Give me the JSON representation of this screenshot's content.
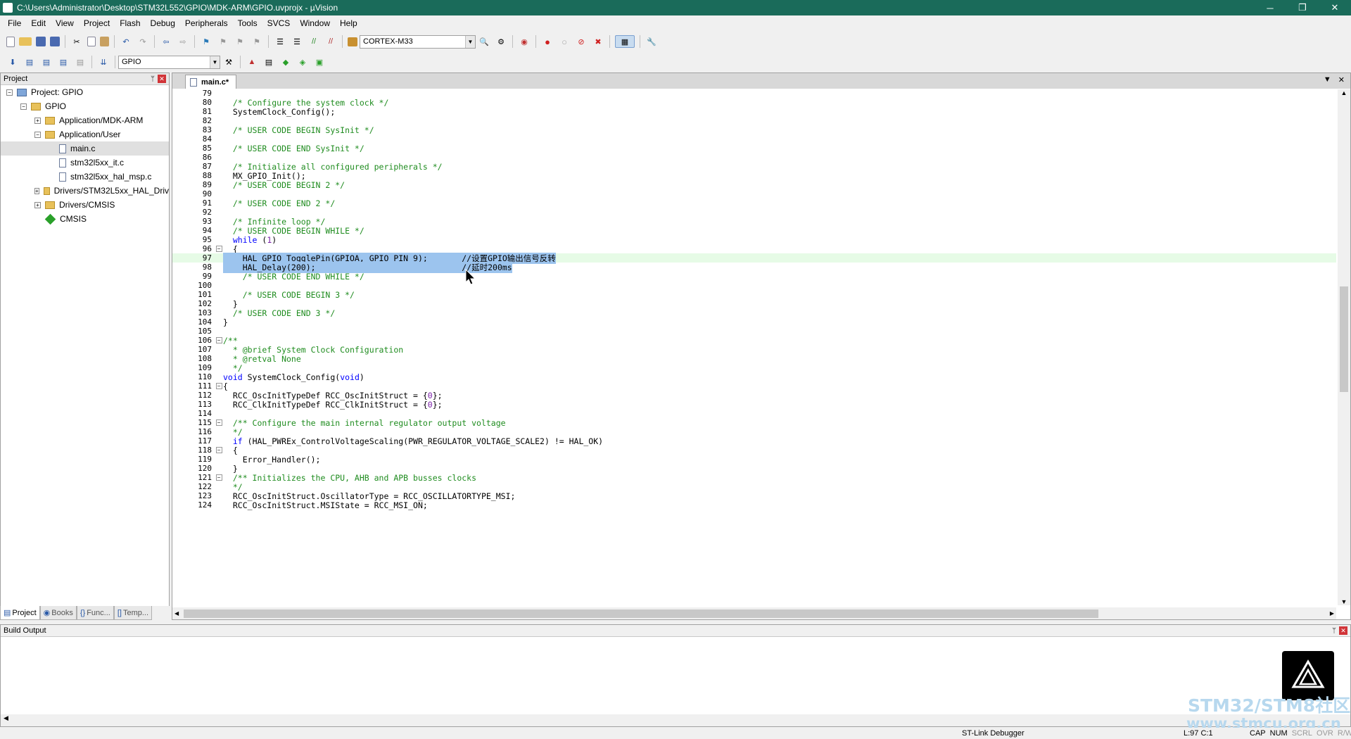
{
  "window": {
    "title": "C:\\Users\\Administrator\\Desktop\\STM32L552\\GPIO\\MDK-ARM\\GPIO.uvprojx - µVision",
    "minimize": "─",
    "maximize": "❐",
    "close": "✕"
  },
  "menu": [
    "File",
    "Edit",
    "View",
    "Project",
    "Flash",
    "Debug",
    "Peripherals",
    "Tools",
    "SVCS",
    "Window",
    "Help"
  ],
  "toolbar": {
    "device_combo": "CORTEX-M33",
    "target_combo": "GPIO"
  },
  "project_panel": {
    "title": "Project",
    "pin": "ᛘ",
    "close": "✕",
    "tree": [
      {
        "label": "Project: GPIO",
        "level": 0,
        "kind": "proj",
        "exp": "−"
      },
      {
        "label": "GPIO",
        "level": 1,
        "kind": "folder",
        "exp": "−"
      },
      {
        "label": "Application/MDK-ARM",
        "level": 2,
        "kind": "folder",
        "exp": "+"
      },
      {
        "label": "Application/User",
        "level": 2,
        "kind": "folder",
        "exp": "−"
      },
      {
        "label": "main.c",
        "level": 3,
        "kind": "file",
        "exp": "",
        "selected": true
      },
      {
        "label": "stm32l5xx_it.c",
        "level": 3,
        "kind": "file",
        "exp": ""
      },
      {
        "label": "stm32l5xx_hal_msp.c",
        "level": 3,
        "kind": "file",
        "exp": ""
      },
      {
        "label": "Drivers/STM32L5xx_HAL_Driv",
        "level": 2,
        "kind": "folder",
        "exp": "+"
      },
      {
        "label": "Drivers/CMSIS",
        "level": 2,
        "kind": "folder",
        "exp": "+"
      },
      {
        "label": "CMSIS",
        "level": 2,
        "kind": "diamond",
        "exp": ""
      }
    ],
    "tabs": [
      {
        "label": "Project",
        "icon": "▤",
        "active": true
      },
      {
        "label": "Books",
        "icon": "◉",
        "active": false
      },
      {
        "label": "Func...",
        "icon": "{}",
        "active": false
      },
      {
        "label": "Temp...",
        "icon": "[]",
        "active": false
      }
    ]
  },
  "editor": {
    "tab": "main.c*",
    "tab_menu": "▼",
    "tab_close": "✕",
    "lines": [
      {
        "n": "79",
        "t": "",
        "fold": ""
      },
      {
        "n": "80",
        "t": "  /* Configure the system clock */",
        "fold": "",
        "cls": "com"
      },
      {
        "n": "81",
        "t": "  SystemClock_Config();",
        "fold": ""
      },
      {
        "n": "82",
        "t": "",
        "fold": ""
      },
      {
        "n": "83",
        "t": "  /* USER CODE BEGIN SysInit */",
        "fold": "",
        "cls": "com"
      },
      {
        "n": "84",
        "t": "",
        "fold": ""
      },
      {
        "n": "85",
        "t": "  /* USER CODE END SysInit */",
        "fold": "",
        "cls": "com"
      },
      {
        "n": "86",
        "t": "",
        "fold": ""
      },
      {
        "n": "87",
        "t": "  /* Initialize all configured peripherals */",
        "fold": "",
        "cls": "com"
      },
      {
        "n": "88",
        "t": "  MX_GPIO_Init();",
        "fold": ""
      },
      {
        "n": "89",
        "t": "  /* USER CODE BEGIN 2 */",
        "fold": "",
        "cls": "com"
      },
      {
        "n": "90",
        "t": "",
        "fold": ""
      },
      {
        "n": "91",
        "t": "  /* USER CODE END 2 */",
        "fold": "",
        "cls": "com"
      },
      {
        "n": "92",
        "t": "",
        "fold": ""
      },
      {
        "n": "93",
        "t": "  /* Infinite loop */",
        "fold": "",
        "cls": "com"
      },
      {
        "n": "94",
        "t": "  /* USER CODE BEGIN WHILE */",
        "fold": "",
        "cls": "com"
      },
      {
        "n": "95",
        "t": "  while (1)",
        "fold": "",
        "cls": "while"
      },
      {
        "n": "96",
        "t": "  {",
        "fold": "−"
      },
      {
        "n": "97",
        "t": "    HAL_GPIO_TogglePin(GPIOA, GPIO_PIN_9);       //设置GPIO输出信号反转",
        "fold": "",
        "sel": true,
        "hl": true
      },
      {
        "n": "98",
        "t": "    HAL_Delay(200);                              //延时200ms",
        "fold": "",
        "sel": true
      },
      {
        "n": "99",
        "t": "    /* USER CODE END WHILE */",
        "fold": "",
        "cls": "com"
      },
      {
        "n": "100",
        "t": "",
        "fold": ""
      },
      {
        "n": "101",
        "t": "    /* USER CODE BEGIN 3 */",
        "fold": "",
        "cls": "com"
      },
      {
        "n": "102",
        "t": "  }",
        "fold": ""
      },
      {
        "n": "103",
        "t": "  /* USER CODE END 3 */",
        "fold": "",
        "cls": "com"
      },
      {
        "n": "104",
        "t": "}",
        "fold": ""
      },
      {
        "n": "105",
        "t": "",
        "fold": ""
      },
      {
        "n": "106",
        "t": "/**",
        "fold": "−",
        "cls": "com"
      },
      {
        "n": "107",
        "t": "  * @brief System Clock Configuration",
        "fold": "",
        "cls": "com"
      },
      {
        "n": "108",
        "t": "  * @retval None",
        "fold": "",
        "cls": "com"
      },
      {
        "n": "109",
        "t": "  */",
        "fold": "",
        "cls": "com"
      },
      {
        "n": "110",
        "t": "void SystemClock_Config(void)",
        "fold": "",
        "cls": "void"
      },
      {
        "n": "111",
        "t": "{",
        "fold": "−"
      },
      {
        "n": "112",
        "t": "  RCC_OscInitTypeDef RCC_OscInitStruct = {0};",
        "fold": ""
      },
      {
        "n": "113",
        "t": "  RCC_ClkInitTypeDef RCC_ClkInitStruct = {0};",
        "fold": ""
      },
      {
        "n": "114",
        "t": "",
        "fold": ""
      },
      {
        "n": "115",
        "t": "  /** Configure the main internal regulator output voltage",
        "fold": "−",
        "cls": "com"
      },
      {
        "n": "116",
        "t": "  */",
        "fold": "",
        "cls": "com"
      },
      {
        "n": "117",
        "t": "  if (HAL_PWREx_ControlVoltageScaling(PWR_REGULATOR_VOLTAGE_SCALE2) != HAL_OK)",
        "fold": "",
        "cls": "if"
      },
      {
        "n": "118",
        "t": "  {",
        "fold": "−"
      },
      {
        "n": "119",
        "t": "    Error_Handler();",
        "fold": ""
      },
      {
        "n": "120",
        "t": "  }",
        "fold": ""
      },
      {
        "n": "121",
        "t": "  /** Initializes the CPU, AHB and APB busses clocks",
        "fold": "−",
        "cls": "com"
      },
      {
        "n": "122",
        "t": "  */",
        "fold": "",
        "cls": "com"
      },
      {
        "n": "123",
        "t": "  RCC_OscInitStruct.OscillatorType = RCC_OSCILLATORTYPE_MSI;",
        "fold": ""
      },
      {
        "n": "124",
        "t": "  RCC_OscInitStruct.MSIState = RCC_MSI_ON;",
        "fold": ""
      }
    ]
  },
  "build_output": {
    "title": "Build Output",
    "pin": "ᛘ",
    "close": "✕"
  },
  "status": {
    "debugger": "ST-Link Debugger",
    "position": "L:97 C:1",
    "flags": [
      {
        "label": "CAP",
        "on": true
      },
      {
        "label": "NUM",
        "on": true
      },
      {
        "label": "SCRL",
        "on": false
      },
      {
        "label": "OVR",
        "on": false
      },
      {
        "label": "R/W",
        "on": false
      }
    ]
  },
  "watermark": {
    "line1": "STM32/STM8社区",
    "line2": "www.stmcu.org.cn"
  },
  "colors": {
    "titlebar": "#1a6b5a",
    "comment": "#1f8c1f",
    "keyword": "#0000ff",
    "selection": "#9cc4ee",
    "current_line": "#e6fbe6"
  }
}
